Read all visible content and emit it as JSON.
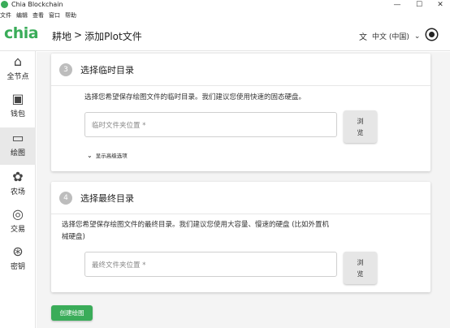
{
  "window": {
    "title": "Chia Blockchain",
    "minimize": "—",
    "maximize": "☐",
    "close": "✕"
  },
  "menu": [
    "文件",
    "编辑",
    "查看",
    "窗口",
    "帮助"
  ],
  "header": {
    "logo": "chia",
    "breadcrumb_root": "耕地",
    "breadcrumb_sep": ">",
    "breadcrumb_current": "添加Plot文件",
    "language": "中文 (中国)",
    "lang_chevron": "⌄"
  },
  "sidebar": {
    "items": [
      {
        "label": "全节点",
        "icon": "home-icon",
        "glyph": "⌂"
      },
      {
        "label": "钱包",
        "icon": "wallet-icon",
        "glyph": "▣"
      },
      {
        "label": "绘图",
        "icon": "storage-icon",
        "glyph": "▭"
      },
      {
        "label": "农场",
        "icon": "plant-icon",
        "glyph": "✿"
      },
      {
        "label": "交易",
        "icon": "trade-icon",
        "glyph": "◎"
      },
      {
        "label": "密钥",
        "icon": "keys-icon",
        "glyph": "⊛"
      }
    ],
    "active_index": 2
  },
  "step3": {
    "number": "3",
    "title": "选择临时目录",
    "description": "选择您希望保存绘图文件的临时目录。我们建议您使用快速的固态硬盘。",
    "placeholder": "临时文件夹位置 *",
    "browse": "浏览",
    "advanced": "显示高级选项"
  },
  "step4": {
    "number": "4",
    "title": "选择最终目录",
    "description_line1": "选择您希望保存绘图文件的最终目录。我们建议您使用大容量、慢速的硬盘 (比如外置机",
    "description_line2": "械硬盘)",
    "placeholder": "最终文件夹位置 *",
    "browse": "浏览"
  },
  "create_button": "创建绘图",
  "colors": {
    "brand": "#3aac59",
    "sidebar_active": "#e8e8e8",
    "main_bg": "#f4f4f4"
  }
}
